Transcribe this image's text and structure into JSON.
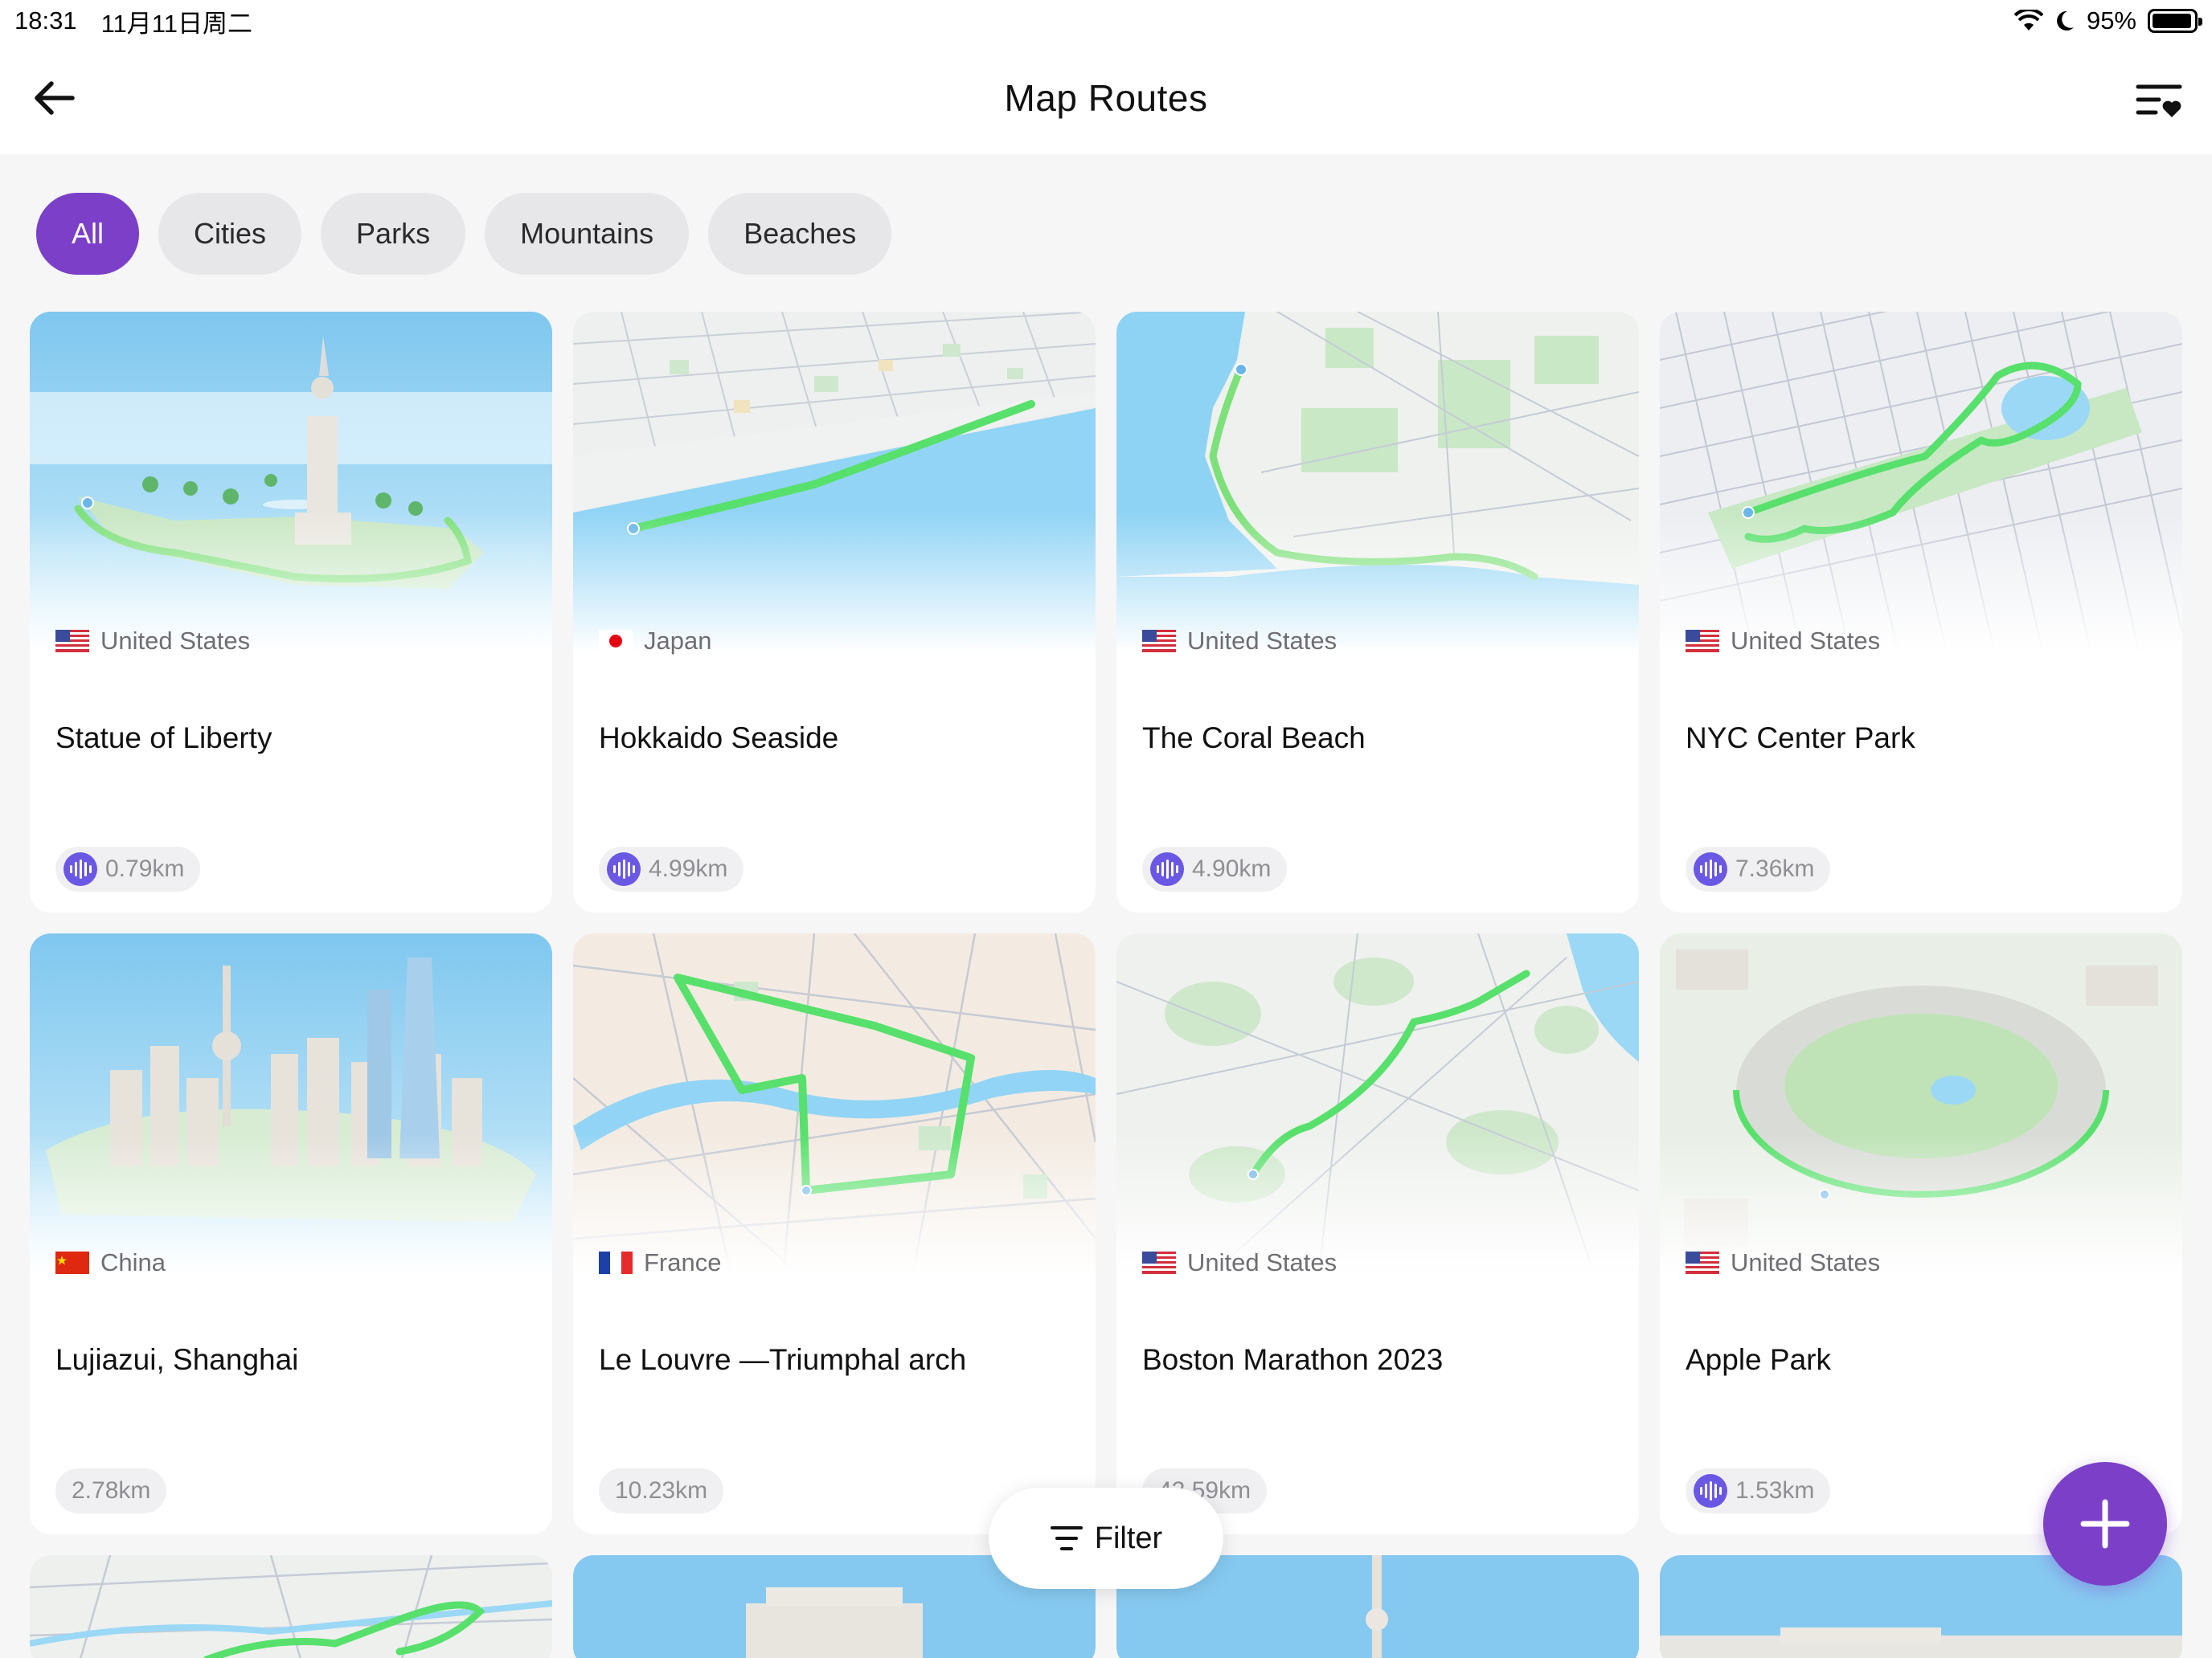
{
  "status_bar": {
    "time": "18:31",
    "date": "11月11日周二",
    "battery": "95%",
    "battery_level": 0.95
  },
  "header": {
    "title": "Map Routes",
    "back_icon": "arrow-left-icon",
    "menu_icon": "list-heart-icon"
  },
  "categories": [
    {
      "label": "All",
      "active": true
    },
    {
      "label": "Cities",
      "active": false
    },
    {
      "label": "Parks",
      "active": false
    },
    {
      "label": "Mountains",
      "active": false
    },
    {
      "label": "Beaches",
      "active": false
    }
  ],
  "routes": [
    {
      "country": "United States",
      "flag": "us",
      "name": "Statue of Liberty",
      "distance": "0.79km",
      "audio": true
    },
    {
      "country": "Japan",
      "flag": "jp",
      "name": "Hokkaido Seaside",
      "distance": "4.99km",
      "audio": true
    },
    {
      "country": "United States",
      "flag": "us",
      "name": "The Coral Beach",
      "distance": "4.90km",
      "audio": true
    },
    {
      "country": "United States",
      "flag": "us",
      "name": "NYC Center Park",
      "distance": "7.36km",
      "audio": true
    },
    {
      "country": "China",
      "flag": "cn",
      "name": "Lujiazui, Shanghai",
      "distance": "2.78km",
      "audio": false
    },
    {
      "country": "France",
      "flag": "fr",
      "name": "Le Louvre —Triumphal arch",
      "distance": "10.23km",
      "audio": false
    },
    {
      "country": "United States",
      "flag": "us",
      "name": "Boston Marathon 2023",
      "distance": "42.59km",
      "audio": false
    },
    {
      "country": "United States",
      "flag": "us",
      "name": "Apple Park",
      "distance": "1.53km",
      "audio": true
    }
  ],
  "filter": {
    "label": "Filter",
    "icon": "filter-lines-icon"
  },
  "fab": {
    "icon": "plus-icon"
  },
  "colors": {
    "accent": "#7b3fc8",
    "route": "#4cd964",
    "audio": "#6a58e4"
  }
}
